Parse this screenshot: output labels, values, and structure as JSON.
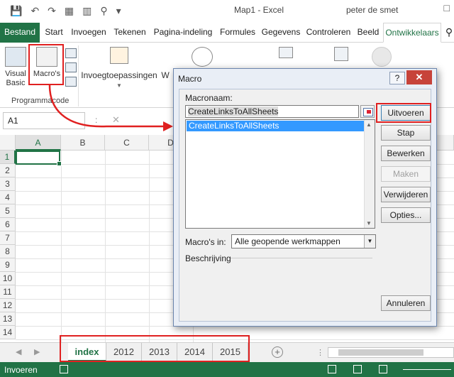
{
  "titlebar": {
    "qat_icons": [
      "save-icon",
      "undo-icon",
      "redo-icon",
      "form-icon",
      "table-icon",
      "preview-icon",
      "customize-icon"
    ],
    "window_title": "Map1 - Excel",
    "user": "peter de smet"
  },
  "ribbon_tabs": [
    {
      "label": "Bestand"
    },
    {
      "label": "Start"
    },
    {
      "label": "Invoegen"
    },
    {
      "label": "Tekenen"
    },
    {
      "label": "Pagina-indeling"
    },
    {
      "label": "Formules"
    },
    {
      "label": "Gegevens"
    },
    {
      "label": "Controleren"
    },
    {
      "label": "Beeld"
    },
    {
      "label": "Ontwikkelaars"
    }
  ],
  "ribbon": {
    "visual_basic": "Visual Basic",
    "macros": "Macro's",
    "group_programmacode": "Programmacode",
    "add_ins": "Invoegtoepassingen",
    "w_partial": "W"
  },
  "formula_bar": {
    "name_box": "A1",
    "sep": ":",
    "cancel": "✕"
  },
  "grid": {
    "columns": [
      "A",
      "B",
      "C",
      "D"
    ],
    "rows": [
      "1",
      "2",
      "3",
      "4",
      "5",
      "6",
      "7",
      "8",
      "9",
      "10",
      "11",
      "12",
      "13",
      "14"
    ],
    "active_cell": "A1"
  },
  "sheet_tabs": [
    "index",
    "2012",
    "2013",
    "2014",
    "2015"
  ],
  "active_sheet": "index",
  "statusbar": {
    "mode": "Invoeren"
  },
  "dialog": {
    "title": "Macro",
    "help": "?",
    "close": "✕",
    "macroname_label": "Macronaam:",
    "macroname_value": "CreateLinksToAllSheets",
    "macros": [
      "CreateLinksToAllSheets"
    ],
    "buttons": {
      "run": "Uitvoeren",
      "step": "Stap",
      "edit": "Bewerken",
      "create": "Maken",
      "delete": "Verwijderen",
      "options": "Opties...",
      "cancel": "Annuleren"
    },
    "macros_in_label": "Macro's in:",
    "macros_in_value": "Alle geopende werkmappen",
    "description_label": "Beschrijving"
  },
  "colors": {
    "excel_green": "#217346",
    "highlight_red": "#e02020",
    "selection_blue": "#3399ff"
  }
}
